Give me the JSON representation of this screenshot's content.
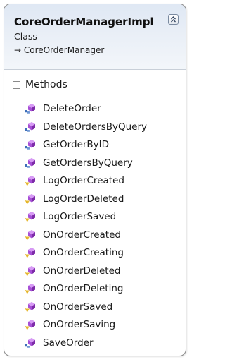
{
  "class": {
    "name": "CoreOrderManagerImpl",
    "stereotype": "Class",
    "inherits": "→ CoreOrderManager"
  },
  "section": {
    "label": "Methods"
  },
  "methods": [
    {
      "name": "DeleteOrder",
      "access": "public"
    },
    {
      "name": "DeleteOrdersByQuery",
      "access": "public"
    },
    {
      "name": "GetOrderByID",
      "access": "public"
    },
    {
      "name": "GetOrdersByQuery",
      "access": "public"
    },
    {
      "name": "LogOrderCreated",
      "access": "protected"
    },
    {
      "name": "LogOrderDeleted",
      "access": "protected"
    },
    {
      "name": "LogOrderSaved",
      "access": "protected"
    },
    {
      "name": "OnOrderCreated",
      "access": "protected"
    },
    {
      "name": "OnOrderCreating",
      "access": "protected"
    },
    {
      "name": "OnOrderDeleted",
      "access": "protected"
    },
    {
      "name": "OnOrderDeleting",
      "access": "protected"
    },
    {
      "name": "OnOrderSaved",
      "access": "protected"
    },
    {
      "name": "OnOrderSaving",
      "access": "protected"
    },
    {
      "name": "SaveOrder",
      "access": "public"
    }
  ],
  "colors": {
    "method_icon": "#a64fd6",
    "public_accent": "#3e6fb8",
    "protected_accent": "#e3b21e"
  }
}
